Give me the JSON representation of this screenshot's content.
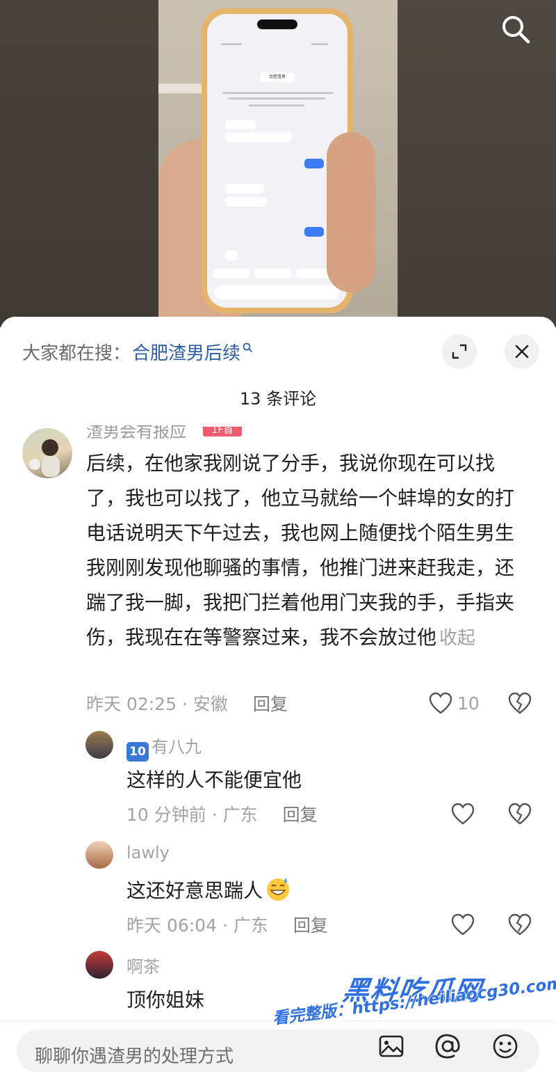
{
  "photo": {
    "chat_screenshot": {
      "system_notice": "合肥渣男",
      "time_1": "23:14",
      "time_2": "07:55",
      "time_3": "10:20",
      "time_4": "18:14",
      "time_5": "18:20"
    }
  },
  "sheet": {
    "search_prefix": "大家都在搜：",
    "search_term": "合肥渣男后续",
    "comment_count": "13 条评论",
    "main_comment": {
      "author_partial": "渣男会有报应",
      "badge": "1F首",
      "text": "后续，在他家我刚说了分手，我说你现在可以找了，我也可以找了，他立马就给一个蚌埠的女的打电话说明天下午过去，我也网上随便找个陌生男生我刚刚发现他聊骚的事情，他推门进来赶我走，还踹了我一脚，我把门拦着他用门夹我的手，手指夹伤，我现在在等警察过来，我不会放过他",
      "collapse_label": "收起",
      "time_location": "昨天 02:25 · 安徽",
      "reply_label": "回复",
      "like_count": "10"
    },
    "replies": [
      {
        "badge": "10",
        "name": "有八九",
        "text": "这样的人不能便宜他",
        "time_location": "10 分钟前 · 广东",
        "reply_label": "回复"
      },
      {
        "name": "lawly",
        "text": "这还好意思踹人",
        "time_location": "昨天 06:04 · 广东",
        "reply_label": "回复"
      },
      {
        "name": "啊茶",
        "text": "顶你姐妹"
      }
    ]
  },
  "bottom_bar": {
    "input_placeholder": "聊聊你遇渣男的处理方式"
  },
  "watermark": {
    "logo": "黑料吃瓜网",
    "url": "看完整版：https://heiliaocg30.com"
  },
  "colors": {
    "link_blue": "#2d5ea4",
    "badge_red": "#f05a6e",
    "watermark_blue": "#2f6fe0"
  },
  "icons": [
    "search-icon",
    "expand-icon",
    "close-icon",
    "heart-icon",
    "broken-heart-icon",
    "image-icon",
    "at-icon",
    "emoji-icon"
  ]
}
